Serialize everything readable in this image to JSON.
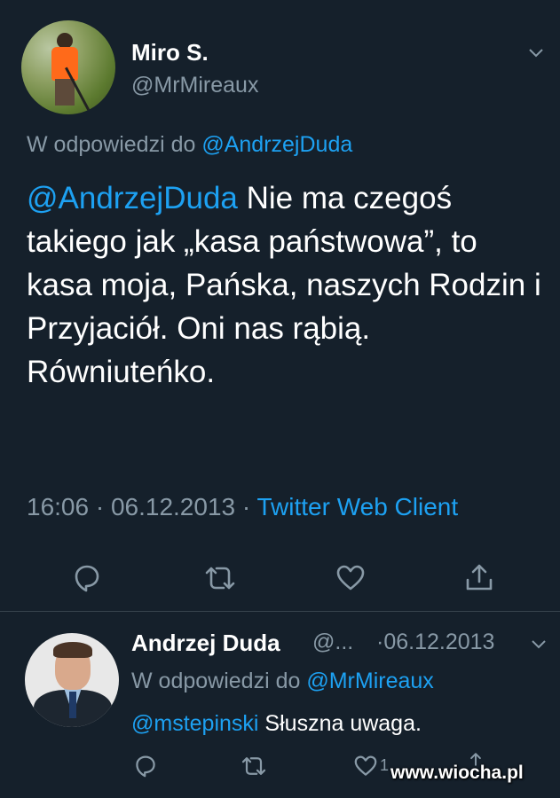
{
  "tweet": {
    "author_name": "Miro S.",
    "author_handle": "@MrMireaux",
    "reply_prefix": "W odpowiedzi do",
    "reply_to": "@AndrzejDuda",
    "mention": "@AndrzejDuda",
    "text": " Nie ma czegoś takiego jak „kasa państwowa”, to kasa moja, Pańska, naszych Rodzin i Przyjaciół. Oni nas rąbią. Równiuteńko.",
    "time_date": "16:06 · 06.12.2013 · ",
    "client": "Twitter Web Client",
    "actions": [
      "reply-icon",
      "retweet-icon",
      "like-icon",
      "share-icon"
    ]
  },
  "reply": {
    "author_name": "Andrzej Duda",
    "author_handle": "@...",
    "date": "·06.12.2013",
    "reply_prefix": "W odpowiedzi do",
    "reply_to": "@MrMireaux",
    "mention": "@mstepinski",
    "text": " Słuszna uwaga.",
    "like_count": "1"
  },
  "watermark": "www.wiocha.pl",
  "colors": {
    "background": "#15202b",
    "link": "#1da1f2",
    "muted": "#8899a6",
    "separator": "#38444d"
  }
}
